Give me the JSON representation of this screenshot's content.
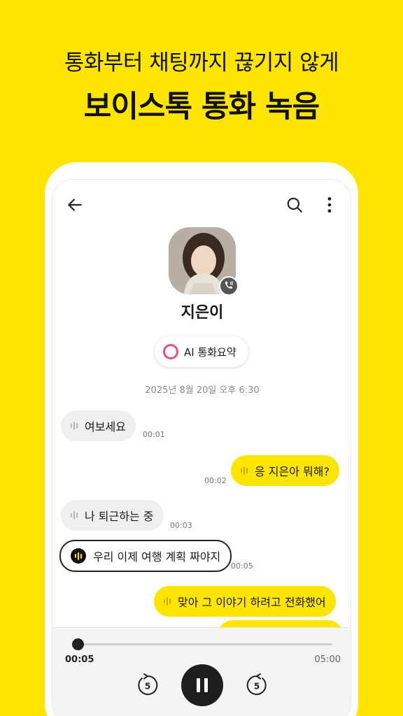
{
  "promo": {
    "subtitle": "통화부터 채팅까지 끊기지 않게",
    "title": "보이스톡 통화 녹음"
  },
  "header": {
    "back_icon": "arrow-left-icon",
    "search_icon": "search-icon",
    "more_icon": "more-vertical-icon"
  },
  "contact": {
    "name": "지은이",
    "badge_icon": "voice-call-icon"
  },
  "ai_summary": {
    "label": "AI 통화요약"
  },
  "date_label": "2025년 8월 20일 오후 6:30",
  "messages": [
    {
      "side": "left",
      "style": "gray",
      "text": "여보세요",
      "time": "00:01"
    },
    {
      "side": "right",
      "style": "yellow",
      "text": "응 지은아 뭐해?",
      "time": "00:02"
    },
    {
      "side": "left",
      "style": "gray",
      "text": "나 퇴근하는 중",
      "time": "00:03"
    },
    {
      "side": "left",
      "style": "active",
      "text": "우리 이제 여행 계획 짜야지",
      "time": "00:05"
    },
    {
      "side": "right",
      "style": "yellow",
      "text": "맞아 그 이야기 하려고 전화했어",
      "time": ""
    }
  ],
  "player": {
    "current_time": "00:05",
    "duration": "05:00",
    "progress": 0.017,
    "skip_back_label": "5",
    "skip_forward_label": "5",
    "state": "playing"
  },
  "colors": {
    "brand_yellow": "#FEE500",
    "ai_ring": "#e8517e"
  }
}
